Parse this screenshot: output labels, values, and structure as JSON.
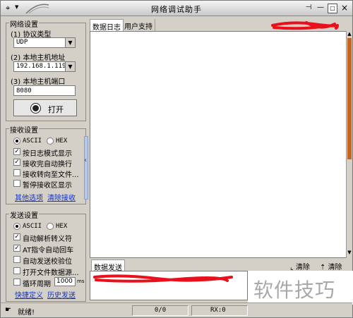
{
  "window": {
    "title": "网络调试助手",
    "pin_glyph": "⊣",
    "min_glyph": "—",
    "max_glyph": "□",
    "close_glyph": "×"
  },
  "net_settings": {
    "title": "网络设置",
    "protocol_label": "(1) 协议类型",
    "protocol_value": "UDP",
    "host_label": "(2) 本地主机地址",
    "host_value": "192.168.1.119",
    "port_label": "(3) 本地主机端口",
    "port_value": "8080",
    "open_button": "打开"
  },
  "recv_settings": {
    "title": "接收设置",
    "mode_ascii": "ASCII",
    "mode_hex": "HEX",
    "options": [
      {
        "label": "按日志模式显示",
        "checked": true
      },
      {
        "label": "接收完自动换行",
        "checked": true
      },
      {
        "label": "接收转向至文件...",
        "checked": false
      },
      {
        "label": "暂停接收区显示",
        "checked": false
      }
    ],
    "link_other": "其他选项",
    "link_clear": "清除接收"
  },
  "send_settings": {
    "title": "发送设置",
    "mode_ascii": "ASCII",
    "mode_hex": "HEX",
    "options": [
      {
        "label": "自动解析转义符",
        "checked": true
      },
      {
        "label": "AT指令自动回车",
        "checked": true
      },
      {
        "label": "自动发送校验位",
        "checked": false
      },
      {
        "label": "打开文件数据源...",
        "checked": false
      }
    ],
    "loop_label": "循环周期",
    "loop_value": "1000",
    "loop_unit": "ms",
    "link_shortcut": "快捷定义",
    "link_history": "历史发送"
  },
  "log_panel": {
    "tabs": [
      "数据日志",
      "用户支持"
    ]
  },
  "send_panel": {
    "tab": "数据发送",
    "clear1": "清除",
    "clear2": "清除"
  },
  "statusbar": {
    "status": "就绪!",
    "counter": "0/0",
    "rx": "RX:0"
  },
  "watermark": "软件技巧",
  "colors": {
    "window_bg": "#d4d0c8",
    "scribble": "#e8101a",
    "scroll_thumb": "#c8641e",
    "link": "#1133cc"
  }
}
